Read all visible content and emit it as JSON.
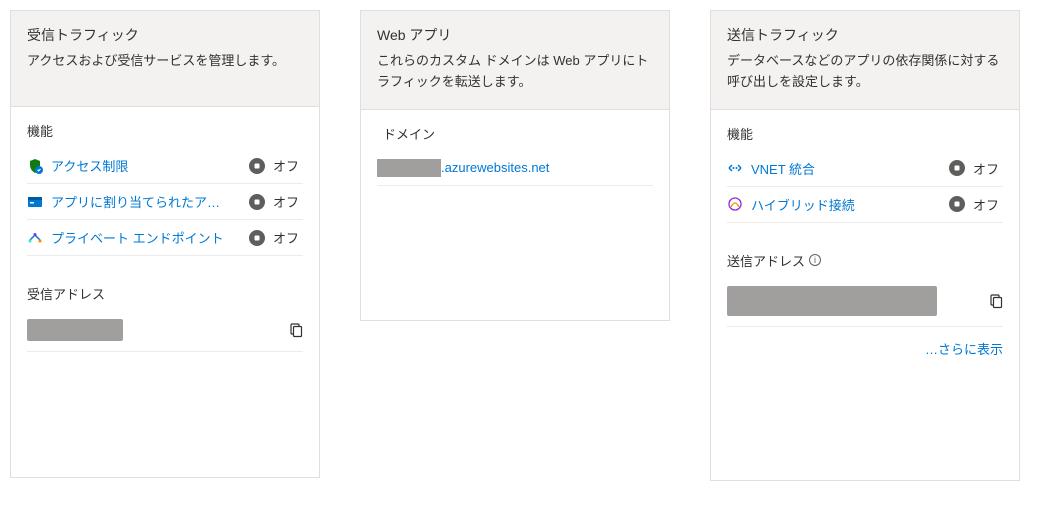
{
  "cards": {
    "inbound": {
      "title": "受信トラフィック",
      "desc": "アクセスおよび受信サービスを管理します。",
      "features_label": "機能",
      "features": [
        {
          "name": "アクセス制限",
          "status": "オフ"
        },
        {
          "name": "アプリに割り当てられたア…",
          "status": "オフ"
        },
        {
          "name": "プライベート エンドポイント",
          "status": "オフ"
        }
      ],
      "address_label": "受信アドレス"
    },
    "webapp": {
      "title": "Web アプリ",
      "desc": "これらのカスタム ドメインは Web アプリにトラフィックを転送します。",
      "domains_label": "ドメイン",
      "domain_suffix": ".azurewebsites.net"
    },
    "outbound": {
      "title": "送信トラフィック",
      "desc": "データベースなどのアプリの依存関係に対する呼び出しを設定します。",
      "features_label": "機能",
      "features": [
        {
          "name": "VNET 統合",
          "status": "オフ"
        },
        {
          "name": "ハイブリッド接続",
          "status": "オフ"
        }
      ],
      "address_label": "送信アドレス",
      "more_label": "…さらに表示"
    }
  }
}
